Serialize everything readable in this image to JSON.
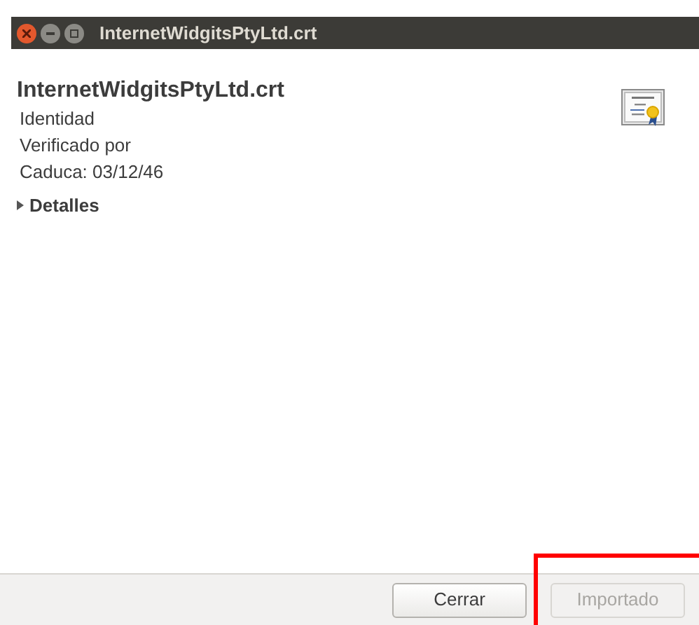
{
  "window": {
    "title": "InternetWidgitsPtyLtd.crt"
  },
  "certificate": {
    "name": "InternetWidgitsPtyLtd.crt",
    "lines": [
      "Identidad",
      "Verificado por",
      "Caduca: 03/12/46"
    ]
  },
  "details": {
    "label": "Detalles",
    "expanded": false
  },
  "buttons": [
    {
      "label": "Cerrar",
      "disabled": false,
      "highlighted": false
    },
    {
      "label": "Importado",
      "disabled": true,
      "highlighted": true
    }
  ]
}
